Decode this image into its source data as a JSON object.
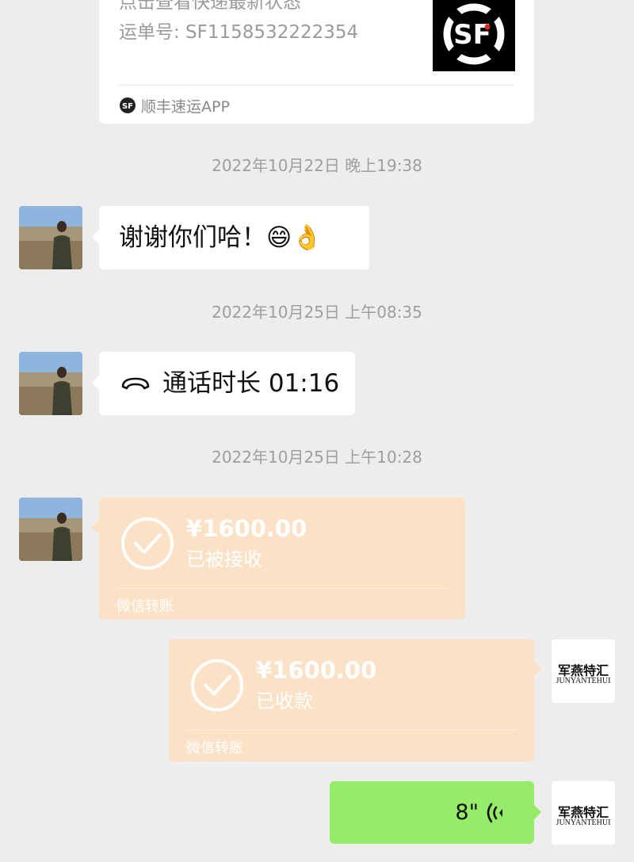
{
  "sf_card": {
    "description": "点击查看快递最新状态",
    "waybill": "运单号: SF1158532222354",
    "app_name": "顺丰速运APP",
    "thumb_label": "SF",
    "thumb_icon": "sf-logo-icon"
  },
  "messages": [
    {
      "type": "timestamp",
      "text": "2022年10月22日 晚上19:38"
    },
    {
      "type": "text",
      "sender": "contact",
      "text": "谢谢你们哈！😄👌"
    },
    {
      "type": "timestamp",
      "text": "2022年10月25日 上午08:35"
    },
    {
      "type": "call",
      "sender": "contact",
      "text": "通话时长 01:16",
      "icon": "phone-hangup-icon"
    },
    {
      "type": "timestamp",
      "text": "2022年10月25日 上午10:28"
    },
    {
      "type": "transfer",
      "sender": "contact",
      "amount": "¥1600.00",
      "status": "已被接收",
      "label": "微信转账"
    },
    {
      "type": "transfer",
      "sender": "self",
      "amount": "¥1600.00",
      "status": "已收款",
      "label": "微信转账"
    },
    {
      "type": "voice",
      "sender": "self",
      "duration": "8\"",
      "icon": "voice-wave-icon"
    }
  ],
  "self_avatar": {
    "line1": "军燕特汇",
    "line2": "JUNYANTEHUI"
  },
  "colors": {
    "background": "#ededed",
    "transfer": "#fbe2c6",
    "voice_bubble": "#95ec69",
    "bubble": "#ffffff"
  }
}
